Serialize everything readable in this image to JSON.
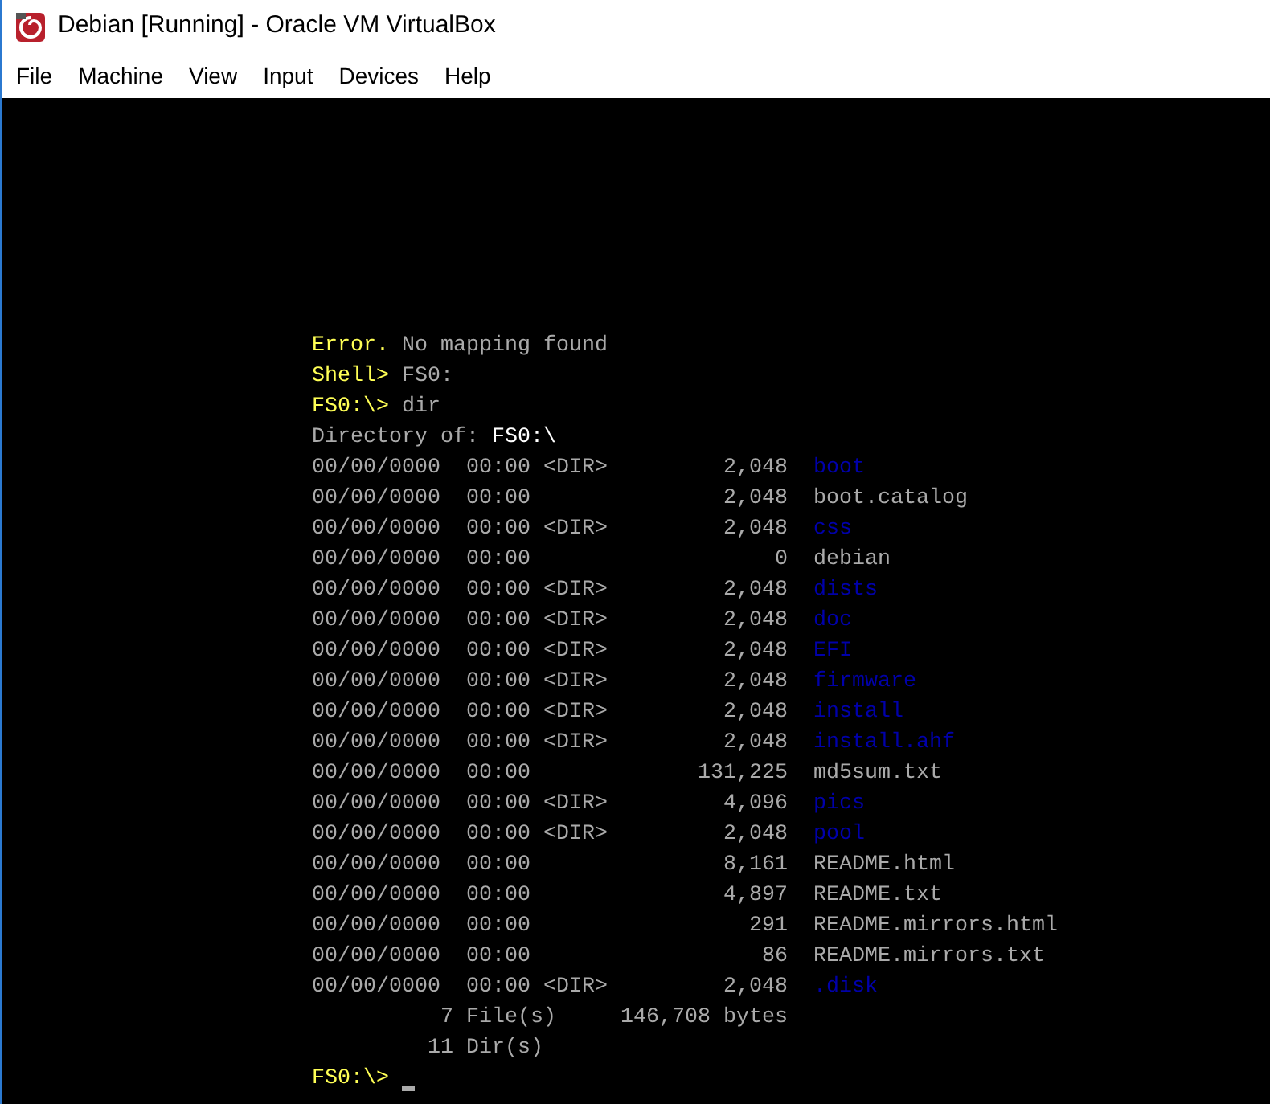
{
  "window": {
    "title": "Debian [Running] - Oracle VM VirtualBox"
  },
  "menu": [
    "File",
    "Machine",
    "View",
    "Input",
    "Devices",
    "Help"
  ],
  "console": {
    "messages": [
      {
        "segments": [
          {
            "text": "Error.",
            "kind": "prompt"
          },
          {
            "text": "No mapping found",
            "kind": "output"
          }
        ]
      },
      {
        "segments": [
          {
            "text": "Shell>",
            "kind": "prompt"
          },
          {
            "text": "FS0:",
            "kind": "output"
          }
        ]
      },
      {
        "segments": [
          {
            "text": "FS0:\\>",
            "kind": "prompt"
          },
          {
            "text": "dir",
            "kind": "output"
          }
        ]
      },
      {
        "segments": [
          {
            "text": "Directory of:",
            "kind": "output"
          },
          {
            "text": "FS0:\\",
            "kind": "emphasis"
          }
        ]
      }
    ],
    "entries": [
      {
        "date": "00/00/0000",
        "time": "00:00",
        "tag": "<DIR>",
        "size": "2,048",
        "name": "boot",
        "directory": true
      },
      {
        "date": "00/00/0000",
        "time": "00:00",
        "size": "2,048",
        "name": "boot.catalog",
        "directory": false
      },
      {
        "date": "00/00/0000",
        "time": "00:00",
        "tag": "<DIR>",
        "size": "2,048",
        "name": "css",
        "directory": true
      },
      {
        "date": "00/00/0000",
        "time": "00:00",
        "size": "0",
        "name": "debian",
        "directory": false
      },
      {
        "date": "00/00/0000",
        "time": "00:00",
        "tag": "<DIR>",
        "size": "2,048",
        "name": "dists",
        "directory": true
      },
      {
        "date": "00/00/0000",
        "time": "00:00",
        "tag": "<DIR>",
        "size": "2,048",
        "name": "doc",
        "directory": true
      },
      {
        "date": "00/00/0000",
        "time": "00:00",
        "tag": "<DIR>",
        "size": "2,048",
        "name": "EFI",
        "directory": true
      },
      {
        "date": "00/00/0000",
        "time": "00:00",
        "tag": "<DIR>",
        "size": "2,048",
        "name": "firmware",
        "directory": true
      },
      {
        "date": "00/00/0000",
        "time": "00:00",
        "tag": "<DIR>",
        "size": "2,048",
        "name": "install",
        "directory": true
      },
      {
        "date": "00/00/0000",
        "time": "00:00",
        "tag": "<DIR>",
        "size": "2,048",
        "name": "install.ahf",
        "directory": true
      },
      {
        "date": "00/00/0000",
        "time": "00:00",
        "size": "131,225",
        "name": "md5sum.txt",
        "directory": false
      },
      {
        "date": "00/00/0000",
        "time": "00:00",
        "tag": "<DIR>",
        "size": "4,096",
        "name": "pics",
        "directory": true
      },
      {
        "date": "00/00/0000",
        "time": "00:00",
        "tag": "<DIR>",
        "size": "2,048",
        "name": "pool",
        "directory": true
      },
      {
        "date": "00/00/0000",
        "time": "00:00",
        "size": "8,161",
        "name": "README.html",
        "directory": false
      },
      {
        "date": "00/00/0000",
        "time": "00:00",
        "size": "4,897",
        "name": "README.txt",
        "directory": false
      },
      {
        "date": "00/00/0000",
        "time": "00:00",
        "size": "291",
        "name": "README.mirrors.html",
        "directory": false
      },
      {
        "date": "00/00/0000",
        "time": "00:00",
        "size": "86",
        "name": "README.mirrors.txt",
        "directory": false
      },
      {
        "date": "00/00/0000",
        "time": "00:00",
        "tag": "<DIR>",
        "size": "2,048",
        "name": ".disk",
        "directory": true
      }
    ],
    "summary": [
      {
        "count": "7",
        "label": "File(s)",
        "total": "146,708",
        "unit": "bytes"
      },
      {
        "count": "11",
        "label": "Dir(s)"
      }
    ],
    "prompt": "FS0:\\>"
  }
}
